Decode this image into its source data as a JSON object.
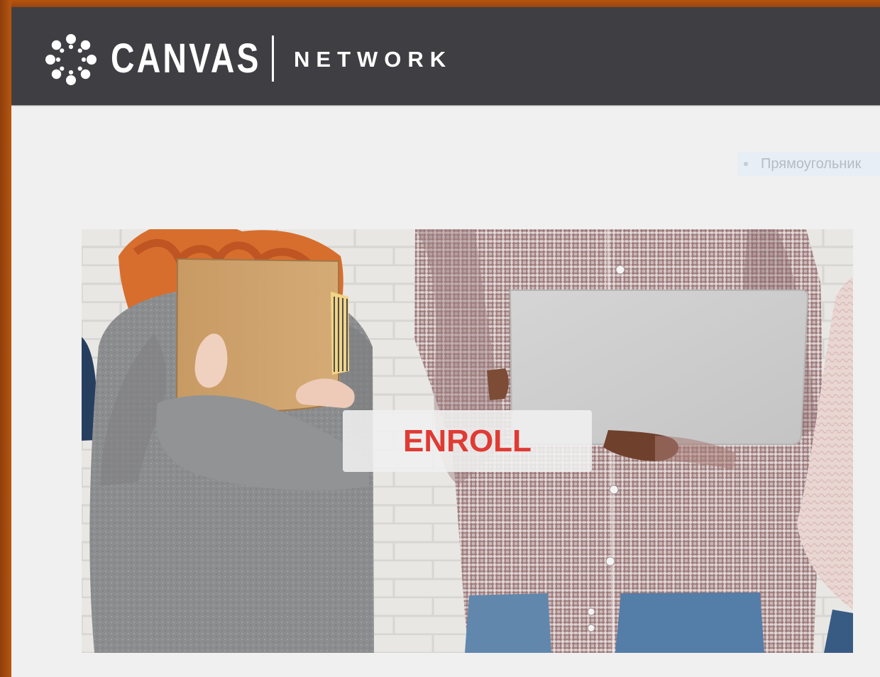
{
  "header": {
    "brand_name": "CANVAS",
    "brand_subtitle": "NETWORK",
    "logo_icon": "canvas-logo-icon"
  },
  "label": {
    "text": "Прямоугольник"
  },
  "hero": {
    "image": "students-holding-notebook-and-laptop",
    "enroll_label": "ENROLL"
  },
  "colors": {
    "header_background": "#3f3f43",
    "accent_red": "#df3b34",
    "page_background": "#f0f0f0",
    "frame_orange": "#a24a12"
  }
}
